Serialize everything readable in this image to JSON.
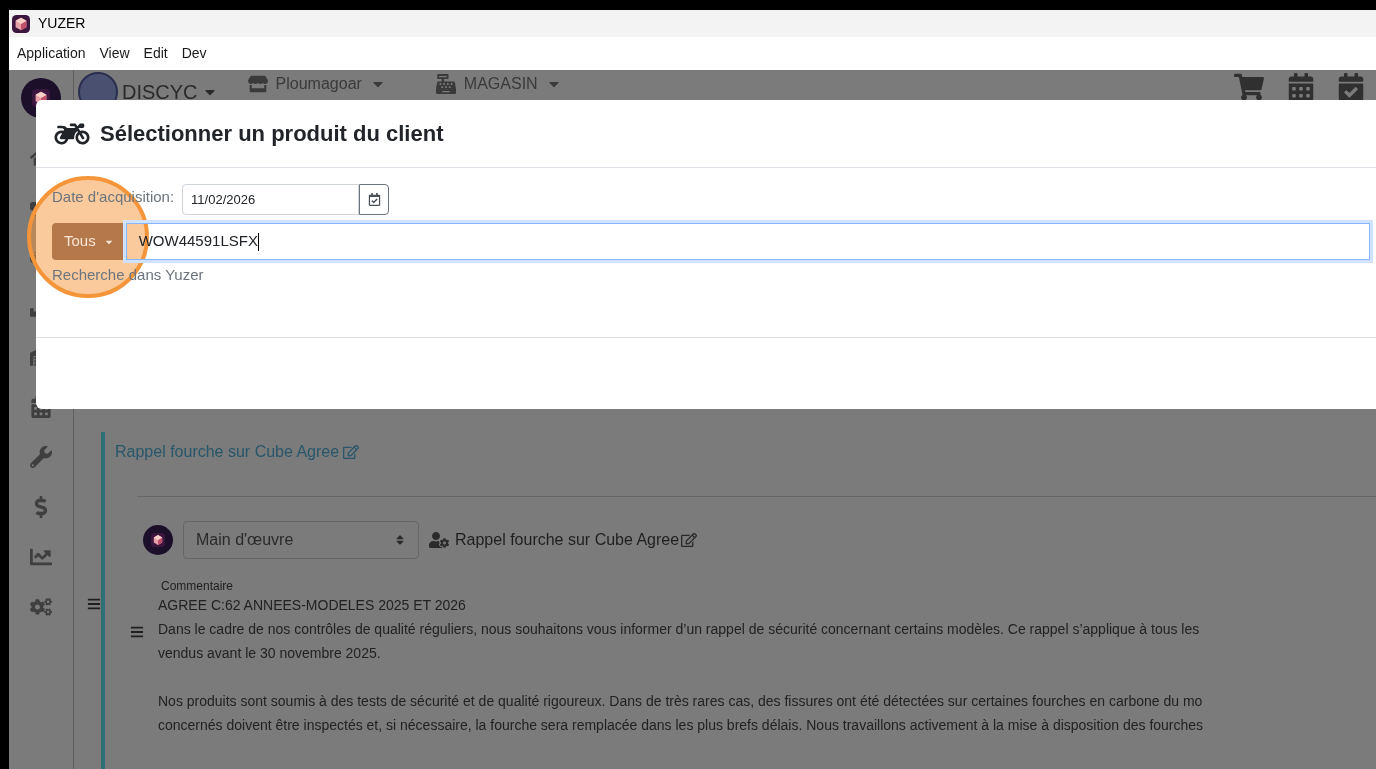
{
  "window": {
    "title": "YUZER"
  },
  "menu": [
    "Application",
    "View",
    "Edit",
    "Dev"
  ],
  "header": {
    "company": "DISCYC",
    "store": "Ploumagoar",
    "register": "MAGASIN"
  },
  "modal": {
    "title": "Sélectionner un produit du client",
    "date_label": "Date d'acquisition:",
    "date_value": "11/02/2026",
    "filter_button": "Tous",
    "search_value": "WOW44591LSFX",
    "search_hint": "Recherche dans Yuzer"
  },
  "intervention": {
    "title": "Rappel fourche sur Cube Agree",
    "labor_select": "Main d'œuvre",
    "labor_title": "Rappel fourche sur Cube Agree",
    "comment_label": "Commentaire",
    "paragraphs": [
      {
        "lines": [
          "AGREE C:62 ANNEES-MODELES 2025 ET 2026",
          "Dans le cadre de nos contrôles de qualité réguliers, nous souhaitons vous informer d’un rappel de sécurité concernant certains modèles. Ce rappel s’applique à tous les",
          "vendus avant le 30 novembre 2025."
        ]
      },
      {
        "lines": [
          "Nos produits sont soumis à des tests de sécurité et de qualité rigoureux. Dans de très rares cas, des fissures ont été détectées sur certaines fourches en carbone du mo",
          "concernés doivent être inspectés et, si nécessaire, la fourche sera remplacée dans les plus brefs délais. Nous travaillons activement à la mise à disposition des fourches"
        ]
      }
    ]
  }
}
